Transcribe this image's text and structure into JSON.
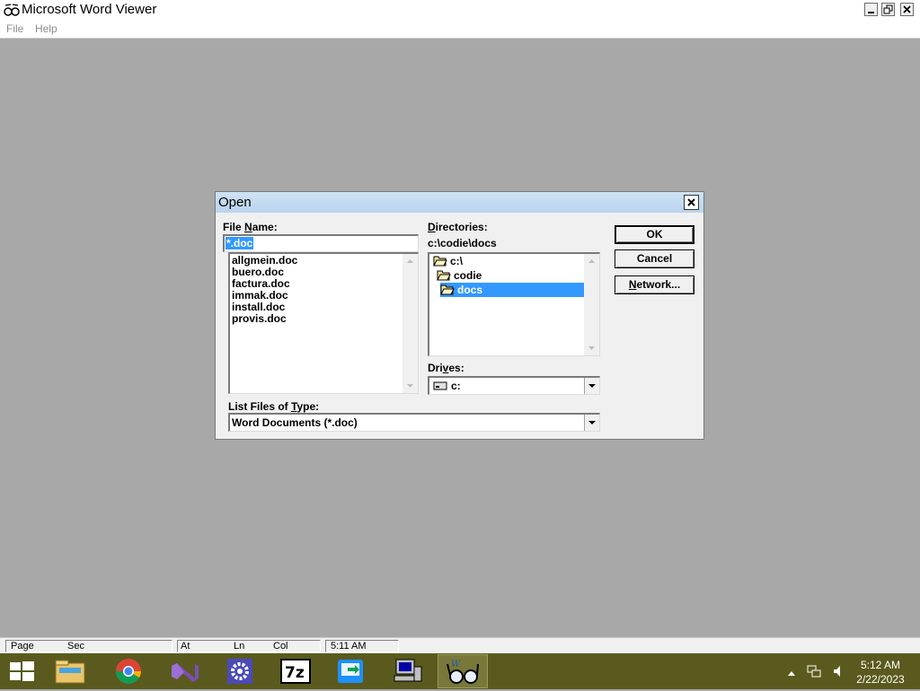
{
  "window": {
    "title": "Microsoft Word Viewer",
    "menu": [
      "File",
      "Help"
    ]
  },
  "dialog": {
    "title": "Open",
    "file_name_label_pre": "File ",
    "file_name_label_key": "N",
    "file_name_label_post": "ame:",
    "file_name_value": "*.doc",
    "files": [
      "allgmein.doc",
      "buero.doc",
      "factura.doc",
      "immak.doc",
      "install.doc",
      "provis.doc"
    ],
    "directories_label_key": "D",
    "directories_label_post": "irectories:",
    "current_path": "c:\\codie\\docs",
    "directories": [
      {
        "name": "c:\\",
        "selected": false
      },
      {
        "name": "codie",
        "selected": false
      },
      {
        "name": "docs",
        "selected": true
      }
    ],
    "drives_label_pre": "Dri",
    "drives_label_key": "v",
    "drives_label_post": "es:",
    "drive_value": "c:",
    "type_label_pre": "List Files of ",
    "type_label_key": "T",
    "type_label_post": "ype:",
    "type_value": "Word Documents (*.doc)",
    "buttons": {
      "ok": "OK",
      "cancel": "Cancel",
      "network_key": "N",
      "network_rest": "etwork..."
    }
  },
  "statusbar": {
    "page": "Page",
    "sec": "Sec",
    "at": "At",
    "ln": "Ln",
    "col": "Col",
    "time": "5:11 AM"
  },
  "taskbar": {
    "apps": [
      "start",
      "file-explorer",
      "chrome",
      "visual-studio",
      "settings",
      "7zip",
      "remote-app",
      "network-computer",
      "word-viewer"
    ],
    "clock_time": "5:12 AM",
    "clock_date": "2/22/2023"
  }
}
